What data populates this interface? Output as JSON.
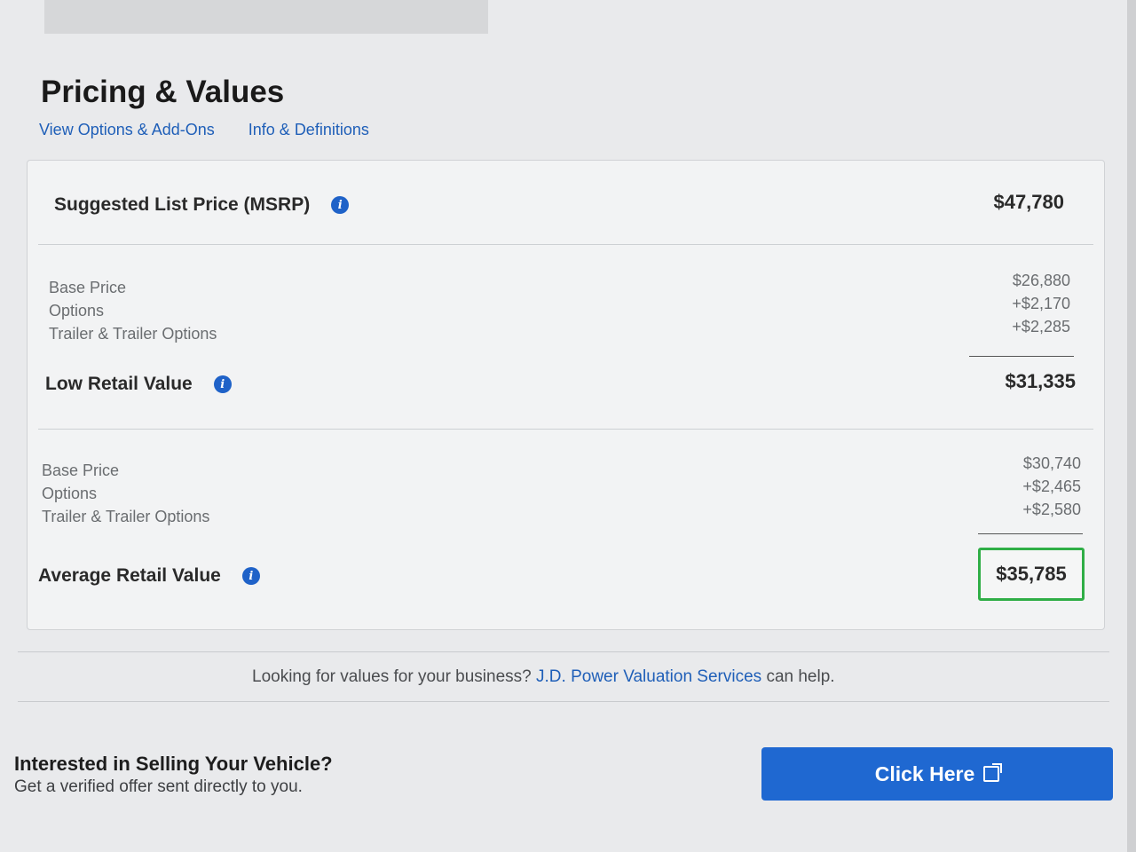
{
  "header": {
    "title": "Pricing & Values",
    "links": [
      "View Options & Add-Ons",
      "Info & Definitions"
    ]
  },
  "msrp": {
    "label": "Suggested List Price (MSRP)",
    "value": "$47,780"
  },
  "low_retail": {
    "details": {
      "labels": [
        "Base Price",
        "Options",
        "Trailer & Trailer Options"
      ],
      "values": [
        "$26,880",
        "+$2,170",
        "+$2,285"
      ]
    },
    "label": "Low Retail Value",
    "value": "$31,335"
  },
  "average_retail": {
    "details": {
      "labels": [
        "Base Price",
        "Options",
        "Trailer & Trailer Options"
      ],
      "values": [
        "$30,740",
        "+$2,465",
        "+$2,580"
      ]
    },
    "label": "Average Retail Value",
    "value": "$35,785"
  },
  "business": {
    "prefix": "Looking for values for your business?",
    "link": "J.D. Power Valuation Services",
    "suffix": "can help."
  },
  "sell": {
    "title": "Interested in Selling Your Vehicle?",
    "subtitle": "Get a verified offer sent directly to you.",
    "button": "Click Here"
  },
  "icons": {
    "info": "info-icon",
    "external": "external-link-icon"
  },
  "colors": {
    "link": "#1f5fb8",
    "button": "#1f68d1",
    "highlight_border": "#2fae46"
  }
}
